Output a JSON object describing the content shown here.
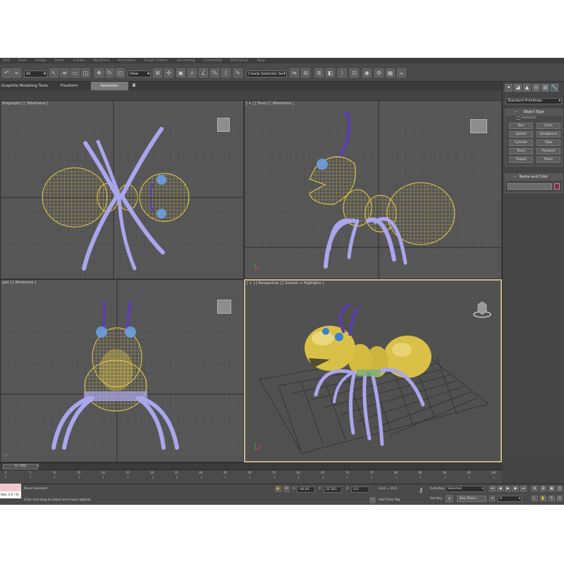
{
  "menu": [
    "Edit",
    "Tools",
    "Group",
    "Views",
    "Create",
    "Modifiers",
    "Animation",
    "Graph Editors",
    "Rendering",
    "Customize",
    "MAXScript",
    "Help"
  ],
  "toolbar": {
    "selection_filter": "All",
    "reference_coord": "View",
    "named_selection": "Create Selection Se"
  },
  "ribbon": {
    "tabs": [
      {
        "label": "Graphite Modeling Tools",
        "active": false
      },
      {
        "label": "Freeform",
        "active": false
      },
      {
        "label": "Selection",
        "active": true
      },
      {
        "label": "◘",
        "active": false
      }
    ]
  },
  "viewports": {
    "top": {
      "label": "thographic ] [ Wireframe ]"
    },
    "front": {
      "label": "[ + ] [ Front ] [ Wireframe ]"
    },
    "right": {
      "label": "ight ] [ Wireframe ]"
    },
    "perspective": {
      "label": "[ + ] [ Perspective ] [ Smooth + Highlights ]"
    }
  },
  "command_panel": {
    "tabs": [
      "✦",
      "◪",
      "▲",
      "◎",
      "▤",
      "🔧"
    ],
    "category": "Standard Primitives",
    "object_type_title": "Object Type",
    "autogrid_label": "AutoGrid",
    "primitives": [
      "Box",
      "Cone",
      "Sphere",
      "GeoSphere",
      "Cylinder",
      "Tube",
      "Torus",
      "Pyramid",
      "Teapot",
      "Plane"
    ],
    "name_color_title": "Name and Color",
    "object_color": "#9a2040"
  },
  "timeline": {
    "slider_label": "0 / 100",
    "ticks": [
      "0",
      "5",
      "10",
      "15",
      "20",
      "25",
      "30",
      "35",
      "40",
      "45",
      "50",
      "55",
      "60",
      "65",
      "70",
      "75",
      "80",
      "85",
      "90",
      "95",
      "100"
    ]
  },
  "status": {
    "selection_status": "None Selected",
    "prompt": "Click and drag to select and move objects",
    "x_label": "X:",
    "x_value": "-44.93",
    "y_label": "Y:",
    "y_value": "22.361",
    "z_label": "Z:",
    "z_value": "0.0",
    "grid": "Grid = 10.0",
    "add_time_tag": "Add Time Tag",
    "auto_key": "Auto Key",
    "auto_key_mode": "Selected",
    "set_key": "Set Key",
    "key_filters": "Key Filters...",
    "frame": "0",
    "listener_text": "Welc  0.0 / 91"
  },
  "colors": {
    "wireframe_yellow": "#e6cc4a",
    "leg_lavender": "#a9a6ee",
    "antenna_purple": "#5a3fb0",
    "eye_blue": "#6fa2e6",
    "body_gold": "#d9c046",
    "active_border": "#c7b98a"
  }
}
